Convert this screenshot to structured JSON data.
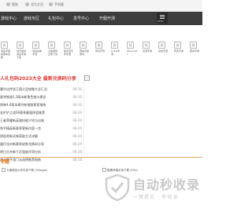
{
  "topbar": {
    "items": [
      "登陆",
      "设为主页",
      "手机版"
    ]
  },
  "nav": {
    "items": [
      "游戏中心",
      "游戏专区",
      "礼包中心",
      "发号中心",
      "开服开测"
    ],
    "menu_label": "MENU"
  },
  "app_strip": [
    {
      "name": "海岛手游新版本宝箱"
    },
    {
      "name": "剑与契约海岛手游下载"
    },
    {
      "name": "海岛战争手游"
    },
    {
      "name": "大鱼游戏正版下载"
    },
    {
      "name": "精灵宝可梦手游"
    },
    {
      "name": "赛车竞速游戏"
    },
    {
      "name": "梦幻开局"
    },
    {
      "name": "kirpki手游"
    },
    {
      "name": "Minecraft"
    },
    {
      "name": "问道手游"
    },
    {
      "name": "射击手游"
    },
    {
      "name": "传奇手游"
    },
    {
      "name": "赛车手游"
    }
  ],
  "headline": "人礼包码2023大全 最新兑换码分享",
  "news": [
    {
      "title": "塞尔达传说王国之泪攻略大全汇总",
      "date": "06-30"
    },
    {
      "title": "星穹铁道1.2版本新角色抽卡建议",
      "date": "06-30"
    },
    {
      "title": "原神4.0版本枫丹新地图探索指南",
      "date": "06-30"
    },
    {
      "title": "金铲铲之战S9赛季最强阵容推荐",
      "date": "06-29"
    },
    {
      "title": "王者荣耀新英雄技能介绍与出装",
      "date": "06-29"
    },
    {
      "title": "和平精英新赛季更新内容一览",
      "date": "06-29"
    },
    {
      "title": "阴阳师新式神获取方式详解",
      "date": "06-29"
    },
    {
      "title": "蛋仔派对新赛季皮肤兑换码分享",
      "date": "06-29"
    },
    {
      "title": "明日方舟新干员强度评测分析",
      "date": "06-28"
    },
    {
      "title": "逆水寒手游门派选择推荐指南",
      "date": "06-28"
    }
  ],
  "section": {
    "title": "专题"
  },
  "links_row": [
    {
      "label": "卡通竞技大作手游下载 (Yiliagjal)"
    },
    {
      "label": "像素风格手游下载 (Yilia)"
    }
  ],
  "watermark": {
    "main": "自动秒收录",
    "sub": "一键提交 · 秒收录"
  },
  "colors": {
    "nav_bg": "#3d3d3d",
    "headline": "#e23a3a",
    "section": "#e67a1e",
    "watermark": "#c9c9c9"
  }
}
